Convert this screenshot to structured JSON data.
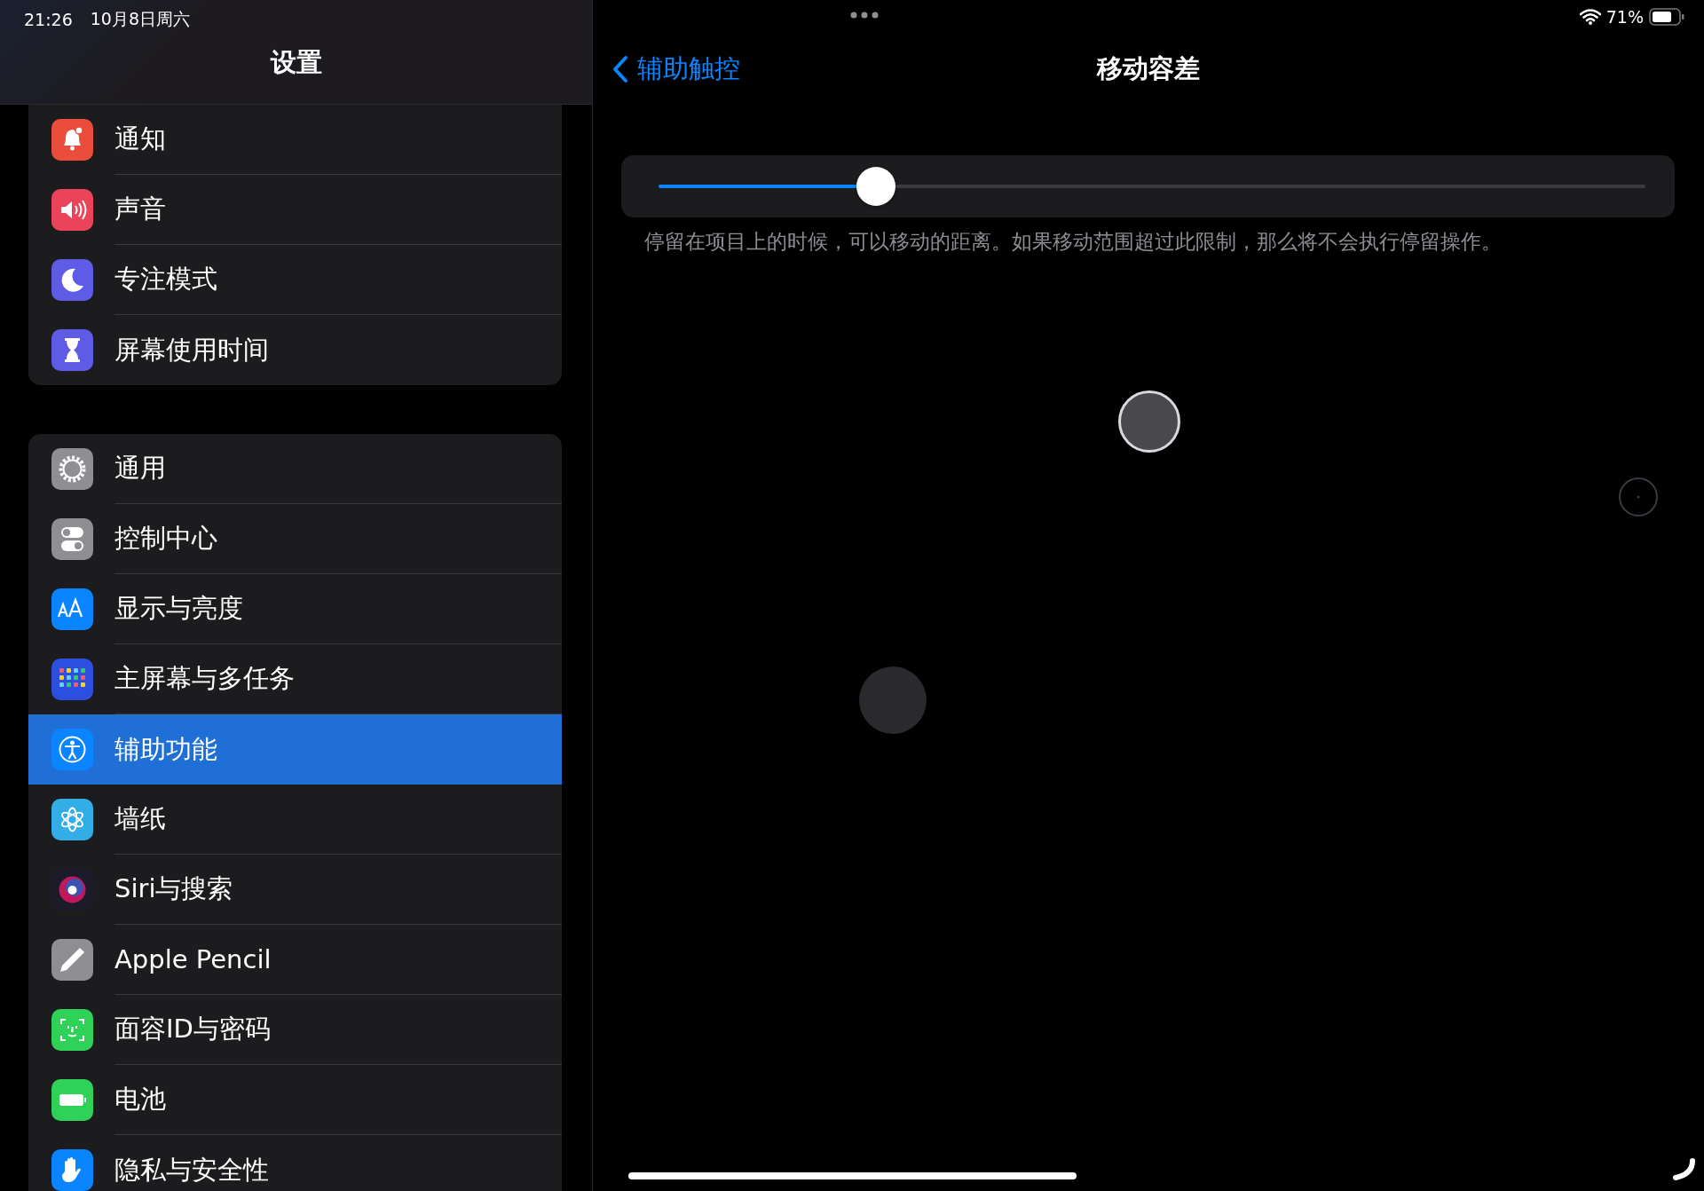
{
  "status_bar": {
    "time": "21:26",
    "date": "10月8日周六",
    "battery_text": "71%"
  },
  "sidebar": {
    "title": "设置",
    "groups": [
      {
        "items": [
          {
            "label": "通知",
            "kind": "bell",
            "selected": false
          },
          {
            "label": "声音",
            "kind": "speaker",
            "selected": false
          },
          {
            "label": "专注模式",
            "kind": "moon",
            "selected": false
          },
          {
            "label": "屏幕使用时间",
            "kind": "hourglass",
            "selected": false
          }
        ]
      },
      {
        "items": [
          {
            "label": "通用",
            "kind": "gear",
            "selected": false
          },
          {
            "label": "控制中心",
            "kind": "toggles",
            "selected": false
          },
          {
            "label": "显示与亮度",
            "kind": "text-size",
            "selected": false
          },
          {
            "label": "主屏幕与多任务",
            "kind": "grid",
            "selected": false
          },
          {
            "label": "辅助功能",
            "kind": "accessibility",
            "selected": true
          },
          {
            "label": "墙纸",
            "kind": "flower",
            "selected": false
          },
          {
            "label": "Siri与搜索",
            "kind": "orb",
            "selected": false
          },
          {
            "label": "Apple Pencil",
            "kind": "pencil",
            "selected": false
          },
          {
            "label": "面容ID与密码",
            "kind": "face",
            "selected": false
          },
          {
            "label": "电池",
            "kind": "battery",
            "selected": false
          },
          {
            "label": "隐私与安全性",
            "kind": "hand",
            "selected": false
          }
        ]
      }
    ]
  },
  "detail": {
    "back_label": "辅助触控",
    "title": "移动容差",
    "slider": {
      "level": 0.22
    },
    "description": "停留在项目上的时候，可以移动的距离。如果移动范围超过此限制，那么将不会执行停留操作。"
  }
}
